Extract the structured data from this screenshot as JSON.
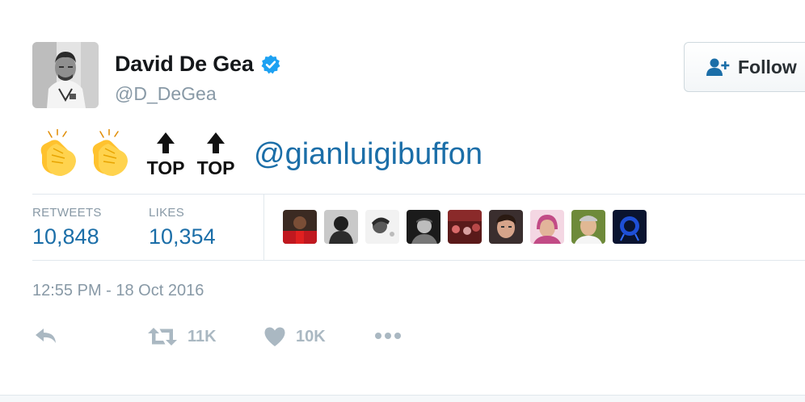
{
  "user": {
    "name": "David De Gea",
    "handle": "@D_DeGea",
    "verified": true,
    "avatar": "profile-photo-black-and-white"
  },
  "follow_button": {
    "label": "Follow",
    "icon": "add-user-icon"
  },
  "tweet": {
    "emojis": [
      "clapping-hands",
      "clapping-hands",
      "top-arrow",
      "top-arrow"
    ],
    "top_label": "TOP",
    "mention": "@gianluigibuffon"
  },
  "stats": {
    "retweets_label": "RETWEETS",
    "retweets_value": "10,848",
    "likes_label": "LIKES",
    "likes_value": "10,354"
  },
  "likers": [
    "liker-avatar-1",
    "liker-avatar-2",
    "liker-avatar-3",
    "liker-avatar-4",
    "liker-avatar-5",
    "liker-avatar-6",
    "liker-avatar-7",
    "liker-avatar-8",
    "liker-avatar-9"
  ],
  "timestamp": "12:55 PM - 18 Oct 2016",
  "actions": {
    "retweet_count": "11K",
    "like_count": "10K"
  },
  "colors": {
    "link": "#1b6ea8",
    "muted": "#8899a6",
    "verified": "#1da1f2",
    "divider": "#e1e8ed",
    "action_icon": "#aab8c2"
  }
}
